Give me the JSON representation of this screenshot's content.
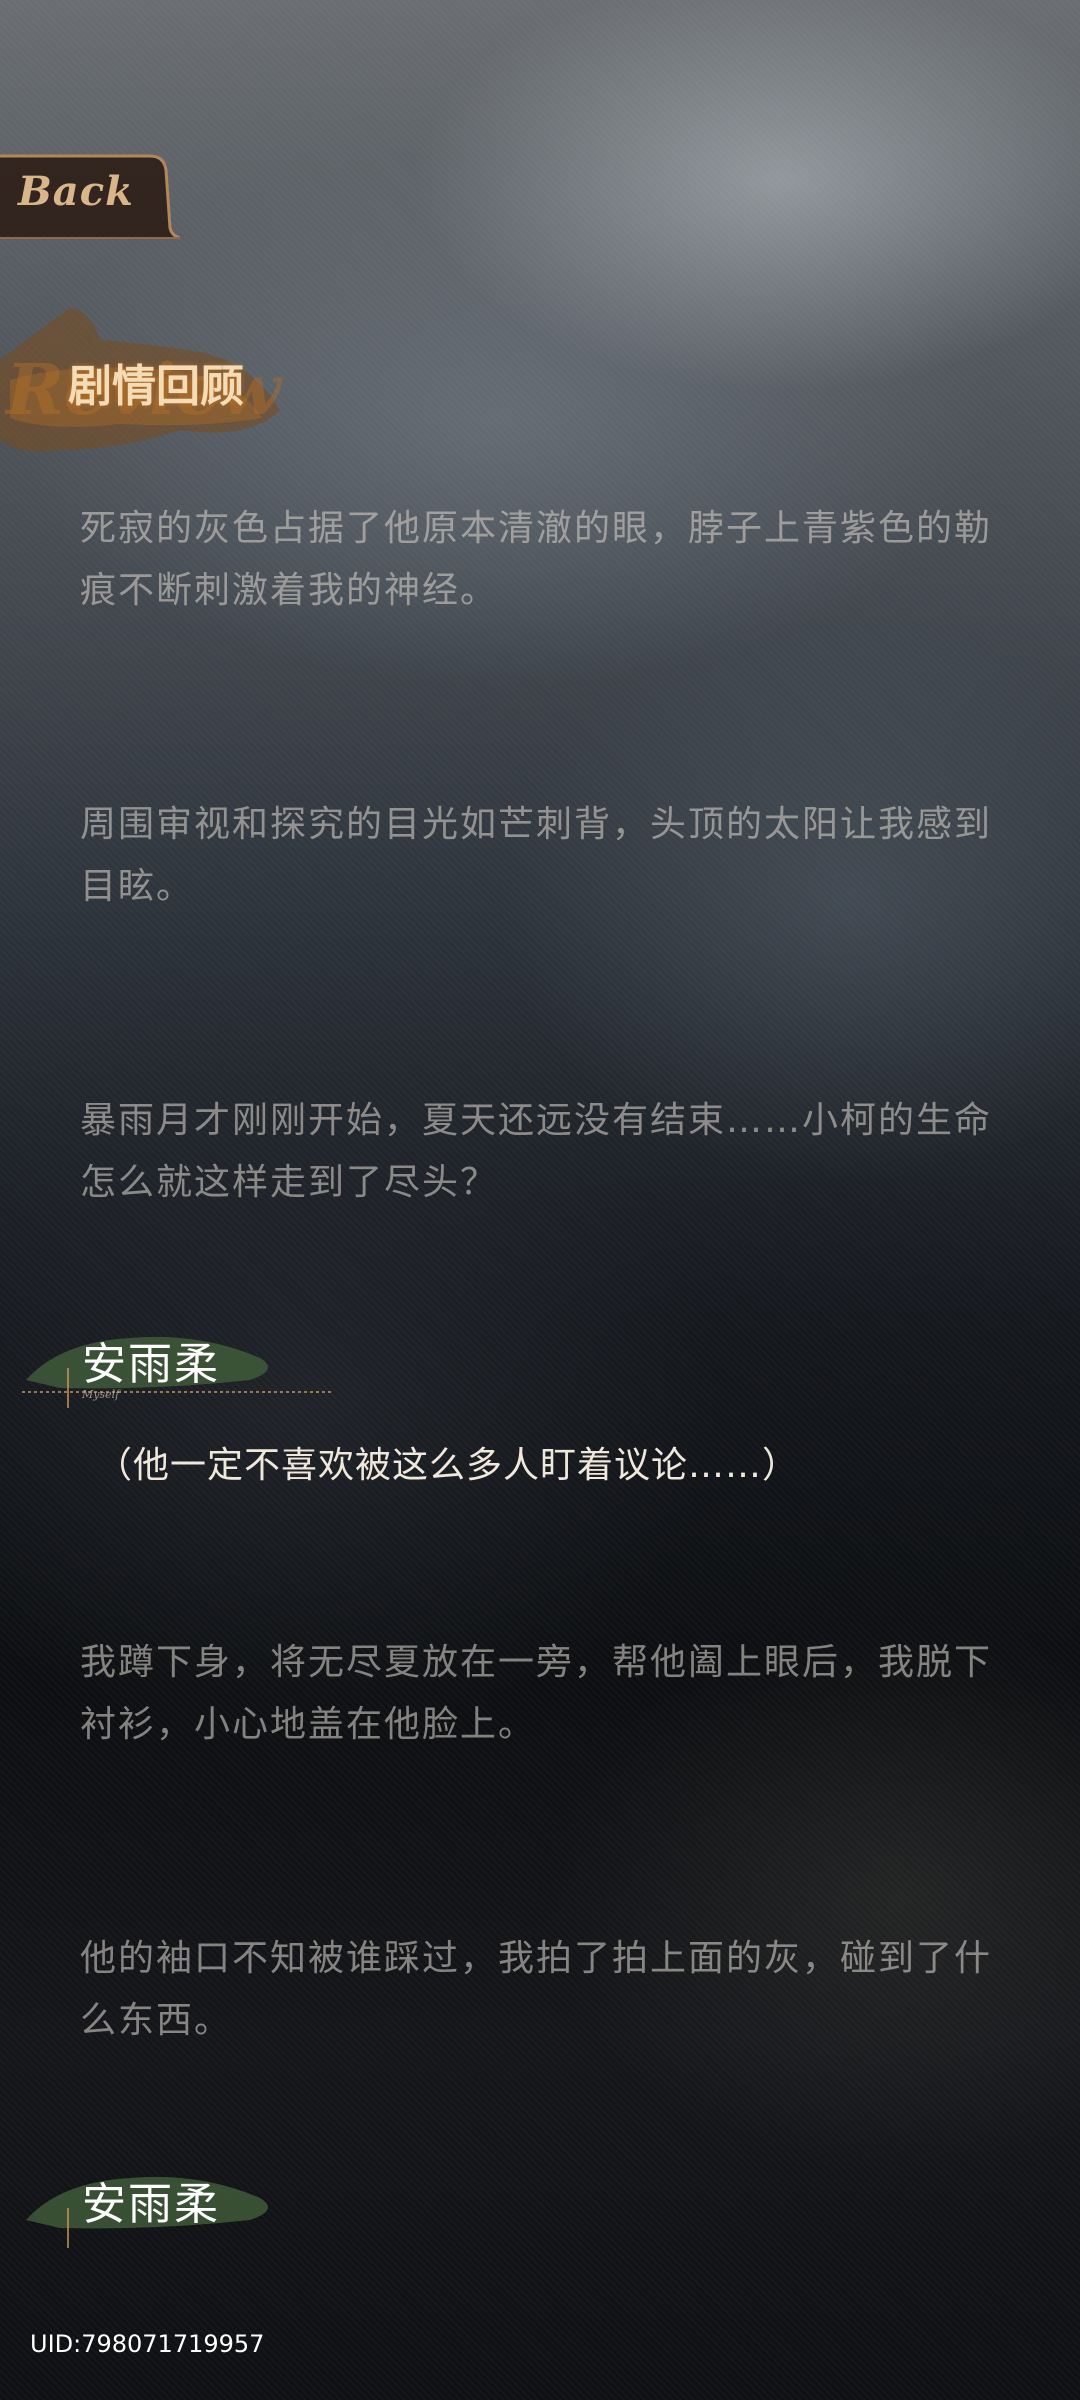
{
  "back_button": {
    "label": "Back"
  },
  "page": {
    "title": "剧情回顾",
    "title_watermark": "Review"
  },
  "entries": [
    {
      "type": "narration",
      "text": "死寂的灰色占据了他原本清澈的眼，脖子上青紫色的勒痕不断刺激着我的神经。"
    },
    {
      "type": "narration",
      "text": "周围审视和探究的目光如芒刺背，头顶的太阳让我感到目眩。"
    },
    {
      "type": "narration",
      "text": "暴雨月才刚刚开始，夏天还远没有结束……小柯的生命怎么就这样走到了尽头？"
    },
    {
      "type": "dialogue",
      "speaker": "安雨柔",
      "speaker_sub": "Myself",
      "text": "（他一定不喜欢被这么多人盯着议论……）"
    },
    {
      "type": "narration",
      "text": "我蹲下身，将无尽夏放在一旁，帮他阖上眼后，我脱下衬衫，小心地盖在他脸上。"
    },
    {
      "type": "narration",
      "text": "他的袖口不知被谁踩过，我拍了拍上面的灰，碰到了什么东西。"
    },
    {
      "type": "dialogue_partial",
      "speaker": "安雨柔"
    }
  ],
  "footer": {
    "uid": "UID:798071719957"
  },
  "colors": {
    "narration_text": "#cdc8c2",
    "dialogue_text": "#f1e8dd",
    "title_text": "#f3dcb6",
    "accent_gold": "#c8955a",
    "speaker_brush": "#3f5a3a"
  }
}
